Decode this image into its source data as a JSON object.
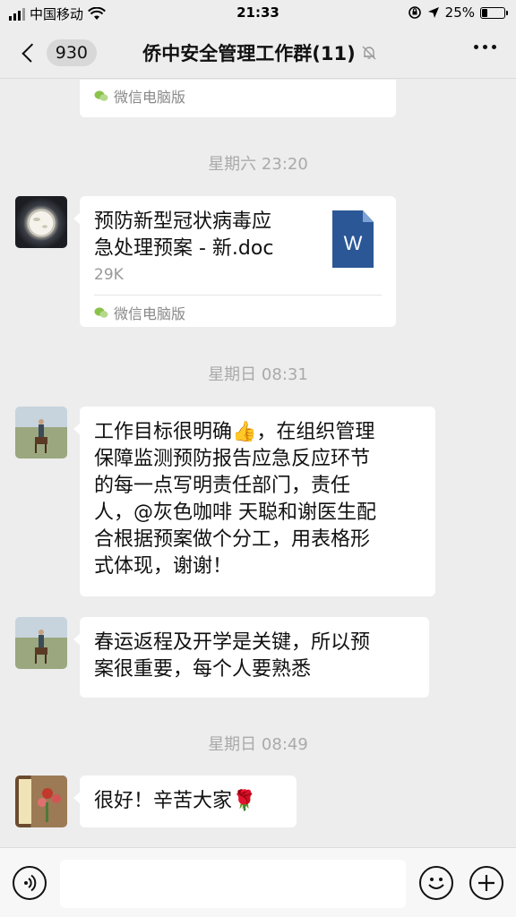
{
  "status_bar": {
    "carrier": "中国移动",
    "time": "21:33",
    "battery_text": "25%",
    "battery_level": 0.25
  },
  "nav": {
    "back_count": "930",
    "title": "侨中安全管理工作群(11)",
    "icons": {
      "back": "chevron-left-icon",
      "mute": "bell-off-icon",
      "more": "ellipsis-icon"
    }
  },
  "messages": {
    "m0": {
      "source": "微信电脑版"
    },
    "t1": "星期六 23:20",
    "m1": {
      "file_name": "预防新型冠状病毒应急处理预案 - 新.doc",
      "file_name_line1": "预防新型冠状病毒应",
      "file_name_line2": "急处理预案 - 新.doc",
      "file_size": "29K",
      "file_icon_label": "W",
      "source": "微信电脑版"
    },
    "t2": "星期日 08:31",
    "m2": {
      "lines": [
        "工作目标很明确👍，在组织管理",
        "保障监测预防报告应急反应环节",
        "的每一点写明责任部门，责任",
        "人，@灰色咖啡 天聪和谢医生配",
        "合根据预案做个分工，用表格形",
        "式体现，谢谢！"
      ]
    },
    "m3": {
      "lines": [
        "春运返程及开学是关键，所以预",
        "案很重要，每个人要熟悉"
      ]
    },
    "t3": "星期日 08:49",
    "m4": {
      "text": "很好！辛苦大家🌹"
    }
  },
  "input_bar": {
    "icons": {
      "voice": "voice-icon",
      "emoji": "emoji-icon",
      "plus": "plus-icon"
    }
  },
  "colors": {
    "background": "#ededed",
    "bubble": "#ffffff",
    "word_icon": "#2b5797",
    "timestamp": "#aaaaaa"
  }
}
